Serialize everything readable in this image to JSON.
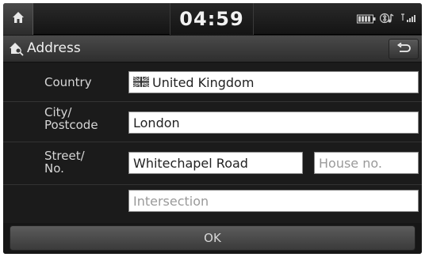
{
  "status_bar": {
    "clock": "04:59",
    "icons": [
      "home-icon",
      "battery-icon",
      "bluetooth-audio-icon",
      "signal-icon"
    ]
  },
  "title_bar": {
    "title": "Address",
    "icon": "home-search-icon",
    "back_icon": "back-arrow-icon"
  },
  "form": {
    "country": {
      "label": "Country",
      "value": "United Kingdom",
      "flag": "uk-flag-icon"
    },
    "city": {
      "label_line1": "City/",
      "label_line2": "Postcode",
      "value": "London"
    },
    "street": {
      "label_line1": "Street/",
      "label_line2": "No.",
      "value": "Whitechapel Road",
      "house_placeholder": "House no."
    },
    "intersection": {
      "placeholder": "Intersection"
    }
  },
  "ok_button": {
    "label": "OK"
  },
  "colors": {
    "background": "#1b1b1b",
    "bar": "#3a3a3a",
    "field": "#ffffff",
    "text": "#d6d6d6"
  }
}
